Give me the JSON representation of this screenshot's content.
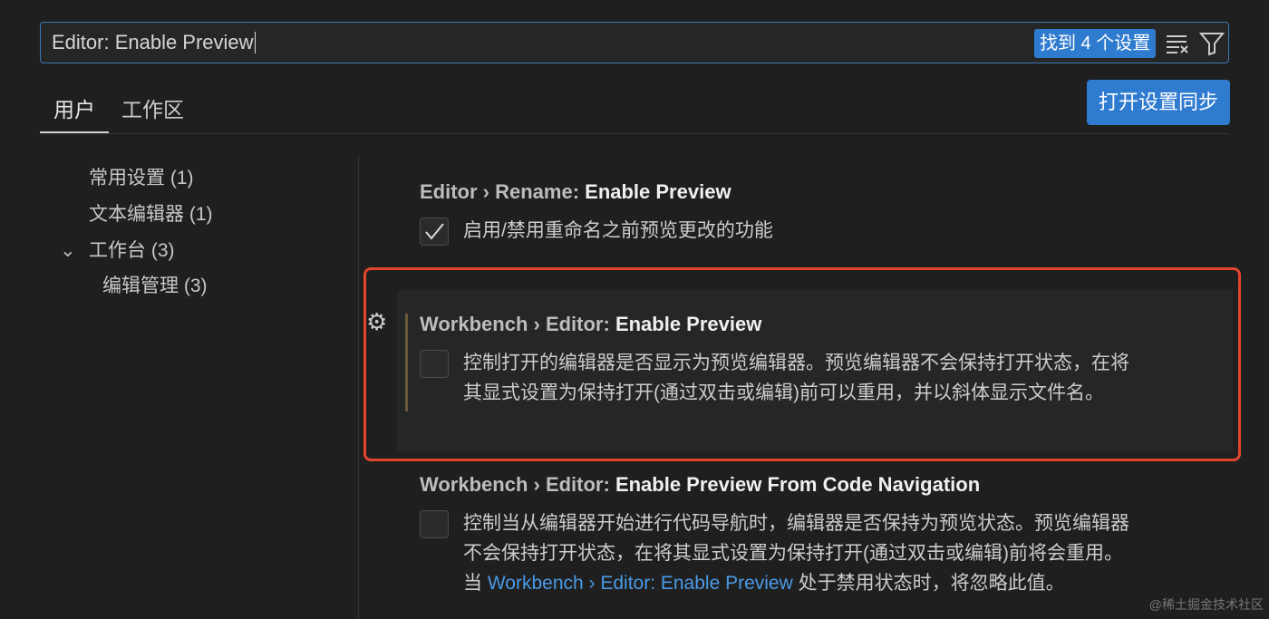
{
  "search": {
    "value": "Editor: Enable Preview",
    "result_count": "找到 4 个设置",
    "clear_icon": "clear-filter-icon",
    "filter_icon": "filter-icon"
  },
  "tabs": [
    {
      "label": "用户",
      "active": true
    },
    {
      "label": "工作区",
      "active": false
    }
  ],
  "sync_button": "打开设置同步",
  "tree": [
    {
      "label": "常用设置 (1)"
    },
    {
      "label": "文本编辑器 (1)"
    },
    {
      "label": "工作台 (3)",
      "expanded": true
    },
    {
      "label": "编辑管理 (3)"
    }
  ],
  "settings": [
    {
      "category": "Editor › Rename: ",
      "name": "Enable Preview",
      "checked": true,
      "description": "启用/禁用重命名之前预览更改的功能"
    },
    {
      "category": "Workbench › Editor: ",
      "name": "Enable Preview",
      "checked": false,
      "description_lines": [
        "控制打开的编辑器是否显示为预览编辑器。预览编辑器不会保持打开状态，在将",
        "其显式设置为保持打开(通过双击或编辑)前可以重用，并以斜体显示文件名。"
      ]
    },
    {
      "category": "Workbench › Editor: ",
      "name": "Enable Preview From Code Navigation",
      "checked": false,
      "description_lines": [
        "控制当从编辑器开始进行代码导航时，编辑器是否保持为预览状态。预览编辑器",
        "不会保持打开状态，在将其显式设置为保持打开(通过双击或编辑)前将会重用。"
      ],
      "line3_prefix": "当 ",
      "line3_link": "Workbench › Editor: Enable Preview",
      "line3_suffix": " 处于禁用状态时，将忽略此值。"
    }
  ],
  "watermark": "@稀土掘金技术社区",
  "colors": {
    "accent": "#2f7bd0",
    "highlight_border": "#e2452d",
    "link": "#4a9ae6"
  }
}
